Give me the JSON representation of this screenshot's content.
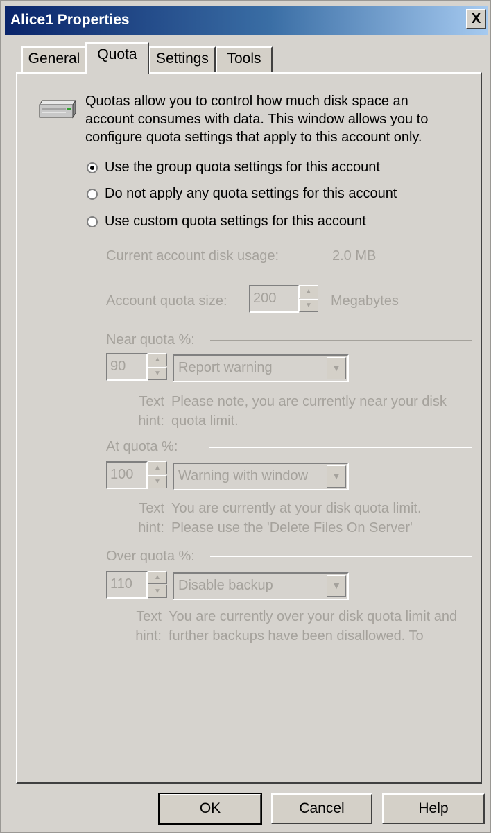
{
  "window": {
    "title": "Alice1 Properties",
    "close_glyph": "X"
  },
  "tabs": [
    {
      "label": "General",
      "active": false
    },
    {
      "label": "Quota",
      "active": true
    },
    {
      "label": "Settings",
      "active": false
    },
    {
      "label": "Tools",
      "active": false
    }
  ],
  "intro": {
    "icon": "drive-icon",
    "line1": "Quotas allow you to control how much disk space an",
    "line2": "account consumes with data.  This window allows you to",
    "line3": "configure quota settings that apply to this account only."
  },
  "options": {
    "group": {
      "label": "Use the group quota settings for this account",
      "checked": true
    },
    "none": {
      "label": "Do not apply any quota settings for this account",
      "checked": false
    },
    "custom": {
      "label": "Use custom quota settings for this account",
      "checked": false
    }
  },
  "usage": {
    "label": "Current account disk usage:",
    "value": "2.0 MB"
  },
  "quota_size": {
    "label": "Account quota size:",
    "value": "200",
    "unit": "Megabytes"
  },
  "near": {
    "label": "Near quota %:",
    "value": "90",
    "action": "Report warning",
    "hint_label_1": "Text",
    "hint_label_2": "hint:",
    "hint_line1": "Please note, you are currently near your disk",
    "hint_line2": "quota limit."
  },
  "at": {
    "label": "At quota %:",
    "value": "100",
    "action": "Warning with window",
    "hint_label_1": "Text",
    "hint_label_2": "hint:",
    "hint_line1": "You are currently at your disk quota limit.",
    "hint_line2": "Please use the 'Delete Files On Server'"
  },
  "over": {
    "label": "Over quota %:",
    "value": "110",
    "action": "Disable backup",
    "hint_label_1": "Text",
    "hint_label_2": "hint:",
    "hint_line1": "You are currently over your disk quota limit and",
    "hint_line2": "further backups have been disallowed.  To"
  },
  "buttons": {
    "ok": "OK",
    "cancel": "Cancel",
    "help": "Help"
  },
  "colors": {
    "title_start": "#0a246a",
    "title_end": "#a6caf0",
    "face": "#d4d0c8",
    "disabled_text": "#a5a29c"
  }
}
